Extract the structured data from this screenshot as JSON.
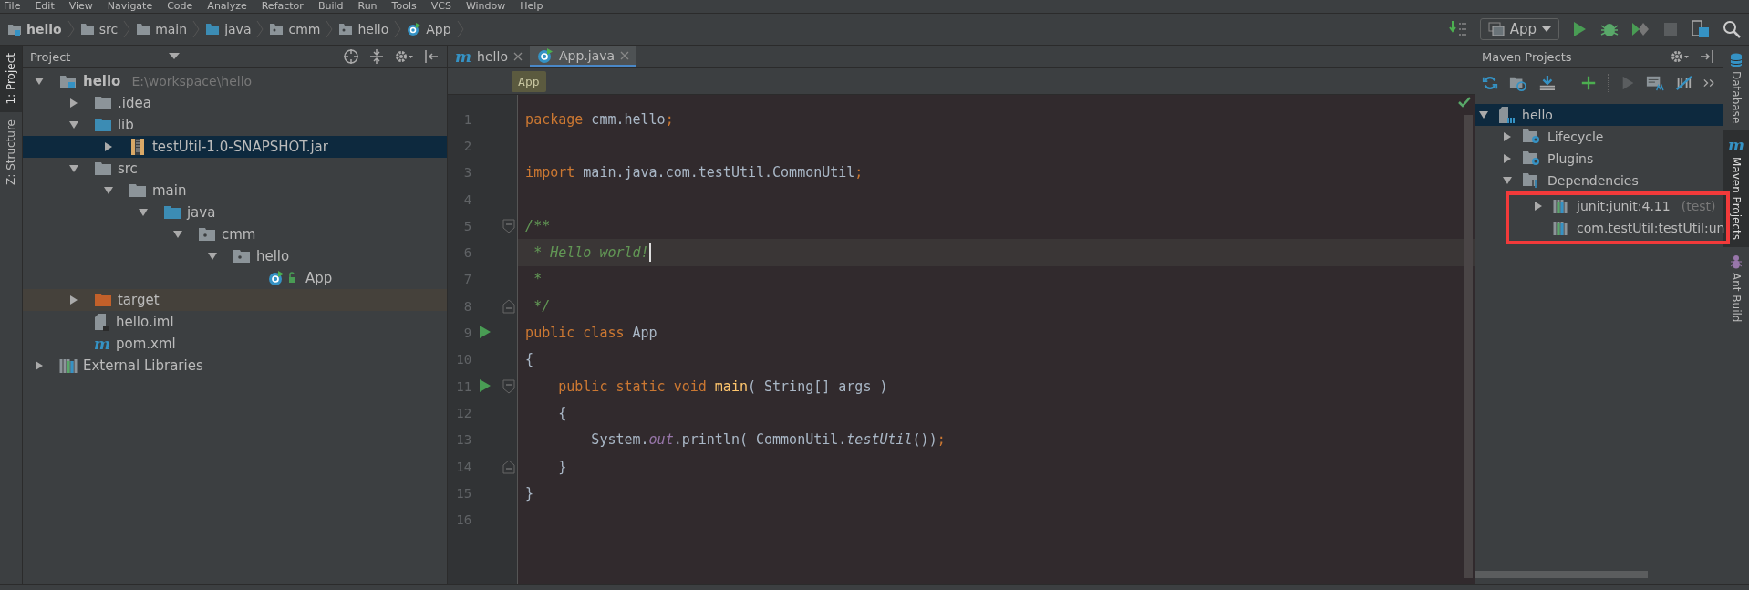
{
  "menu_bar": [
    "File",
    "Edit",
    "View",
    "Navigate",
    "Code",
    "Analyze",
    "Refactor",
    "Build",
    "Run",
    "Tools",
    "VCS",
    "Window",
    "Help"
  ],
  "breadcrumbs": [
    {
      "label": "hello",
      "kind": "module"
    },
    {
      "label": "src",
      "kind": "folder"
    },
    {
      "label": "main",
      "kind": "folder"
    },
    {
      "label": "java",
      "kind": "source-folder"
    },
    {
      "label": "cmm",
      "kind": "package"
    },
    {
      "label": "hello",
      "kind": "package"
    },
    {
      "label": "App",
      "kind": "class"
    }
  ],
  "run_config": {
    "label": "App"
  },
  "left_strip": [
    {
      "label": "1: Project",
      "selected": true
    },
    {
      "label": "Z: Structure",
      "selected": false
    }
  ],
  "project_panel": {
    "title": "Project",
    "tree": [
      {
        "label": "hello",
        "hint": "E:\\workspace\\hello",
        "kind": "module",
        "expanded": true,
        "selected": false,
        "children": [
          {
            "label": ".idea",
            "kind": "folder",
            "expanded": false,
            "selected": false
          },
          {
            "label": "lib",
            "kind": "source-folder",
            "expanded": true,
            "selected": false,
            "children": [
              {
                "label": "testUtil-1.0-SNAPSHOT.jar",
                "kind": "jar",
                "expanded": false,
                "selected": true
              }
            ]
          },
          {
            "label": "src",
            "kind": "folder",
            "expanded": true,
            "selected": false,
            "children": [
              {
                "label": "main",
                "kind": "folder",
                "expanded": true,
                "selected": false,
                "children": [
                  {
                    "label": "java",
                    "kind": "source-folder",
                    "expanded": true,
                    "selected": false,
                    "children": [
                      {
                        "label": "cmm",
                        "kind": "package",
                        "expanded": true,
                        "selected": false,
                        "children": [
                          {
                            "label": "hello",
                            "kind": "package",
                            "expanded": true,
                            "selected": false,
                            "children": [
                              {
                                "label": "App",
                                "kind": "class",
                                "selected": false
                              }
                            ]
                          }
                        ]
                      }
                    ]
                  }
                ]
              }
            ]
          },
          {
            "label": "target",
            "kind": "excluded-folder",
            "expanded": false,
            "selected": false
          },
          {
            "label": "hello.iml",
            "kind": "file",
            "selected": false
          },
          {
            "label": "pom.xml",
            "kind": "maven",
            "logo": "m",
            "selected": false
          }
        ]
      },
      {
        "label": "External Libraries",
        "kind": "libraries",
        "expanded": false,
        "selected": false
      }
    ]
  },
  "editor": {
    "tabs": [
      {
        "label": "hello",
        "kind": "maven",
        "logo": "m",
        "selected": false
      },
      {
        "label": "App.java",
        "kind": "class",
        "selected": true
      }
    ],
    "breadcrumb": "App",
    "lines": [
      {
        "number": "1",
        "run": false,
        "fold_start": false,
        "fold_end": false,
        "current": false,
        "segments": [
          {
            "kind": "keyword",
            "text": "package"
          },
          {
            "kind": "plain",
            "text": " cmm.hello"
          },
          {
            "kind": "keyword",
            "text": ";"
          }
        ]
      },
      {
        "number": "2",
        "run": false,
        "fold_start": false,
        "fold_end": false,
        "current": false
      },
      {
        "number": "3",
        "run": false,
        "fold_start": false,
        "fold_end": false,
        "current": false,
        "segments": [
          {
            "kind": "keyword",
            "text": "import"
          },
          {
            "kind": "plain",
            "text": " main.java.com.testUtil.CommonUtil"
          },
          {
            "kind": "keyword",
            "text": ";"
          }
        ]
      },
      {
        "number": "4",
        "run": false,
        "fold_start": false,
        "fold_end": false,
        "current": false
      },
      {
        "number": "5",
        "run": false,
        "fold_start": true,
        "fold_end": false,
        "current": false,
        "segments": [
          {
            "kind": "doc-comment",
            "text": "/**"
          }
        ]
      },
      {
        "number": "6",
        "run": false,
        "fold_start": false,
        "fold_end": false,
        "current": true,
        "segments": [
          {
            "kind": "doc-comment",
            "text": " * Hello world!"
          }
        ]
      },
      {
        "number": "7",
        "run": false,
        "fold_start": false,
        "fold_end": false,
        "current": false,
        "segments": [
          {
            "kind": "doc-comment",
            "text": " *"
          }
        ]
      },
      {
        "number": "8",
        "run": false,
        "fold_start": false,
        "fold_end": true,
        "current": false,
        "segments": [
          {
            "kind": "doc-comment",
            "text": " */"
          }
        ]
      },
      {
        "number": "9",
        "run": true,
        "fold_start": false,
        "fold_end": false,
        "current": false,
        "segments": [
          {
            "kind": "keyword",
            "text": "public class"
          },
          {
            "kind": "plain",
            "text": " App"
          }
        ]
      },
      {
        "number": "10",
        "run": false,
        "fold_start": false,
        "fold_end": false,
        "current": false,
        "segments": [
          {
            "kind": "plain",
            "text": "{"
          }
        ]
      },
      {
        "number": "11",
        "run": true,
        "fold_start": true,
        "fold_end": false,
        "current": false,
        "segments": [
          {
            "kind": "keyword",
            "text": "    public static void"
          },
          {
            "kind": "method-declaration",
            "text": " main"
          },
          {
            "kind": "plain",
            "text": "( String[] args )"
          }
        ]
      },
      {
        "number": "12",
        "run": false,
        "fold_start": false,
        "fold_end": false,
        "current": false,
        "segments": [
          {
            "kind": "plain",
            "text": "    {"
          }
        ]
      },
      {
        "number": "13",
        "run": false,
        "fold_start": false,
        "fold_end": false,
        "current": false,
        "segments": [
          {
            "kind": "plain",
            "text": "        System."
          },
          {
            "kind": "static-field",
            "text": "out"
          },
          {
            "kind": "plain",
            "text": ".println( CommonUtil."
          },
          {
            "kind": "static-method",
            "text": "testUtil"
          },
          {
            "kind": "plain",
            "text": "())"
          },
          {
            "kind": "keyword",
            "text": ";"
          }
        ]
      },
      {
        "number": "14",
        "run": false,
        "fold_start": false,
        "fold_end": true,
        "current": false,
        "segments": [
          {
            "kind": "plain",
            "text": "    }"
          }
        ]
      },
      {
        "number": "15",
        "run": false,
        "fold_start": false,
        "fold_end": false,
        "current": false,
        "segments": [
          {
            "kind": "plain",
            "text": "}"
          }
        ]
      },
      {
        "number": "16",
        "run": false,
        "fold_start": false,
        "fold_end": false,
        "current": false
      }
    ]
  },
  "maven_panel": {
    "title": "Maven Projects",
    "tree": [
      {
        "label": "hello",
        "kind": "maven-module",
        "expanded": true,
        "selected": true,
        "children": [
          {
            "label": "Lifecycle",
            "kind": "gear-folder",
            "expanded": false,
            "selected": false
          },
          {
            "label": "Plugins",
            "kind": "gear-folder",
            "expanded": false,
            "selected": false
          },
          {
            "label": "Dependencies",
            "kind": "dep-folder",
            "expanded": true,
            "selected": false,
            "children": [
              {
                "label": "junit:junit:4.11",
                "hint": "(test)",
                "kind": "libraries",
                "expanded": false,
                "selected": false
              },
              {
                "label": "com.testUtil:testUtil:un",
                "kind": "libraries",
                "selected": false
              }
            ]
          }
        ]
      }
    ]
  },
  "right_strip": [
    {
      "label": "Database",
      "kind": "database",
      "selected": false
    },
    {
      "label": "Maven Projects",
      "kind": "maven",
      "logo": "m",
      "selected": true
    },
    {
      "label": "Ant Build",
      "kind": "ant",
      "selected": false
    }
  ]
}
